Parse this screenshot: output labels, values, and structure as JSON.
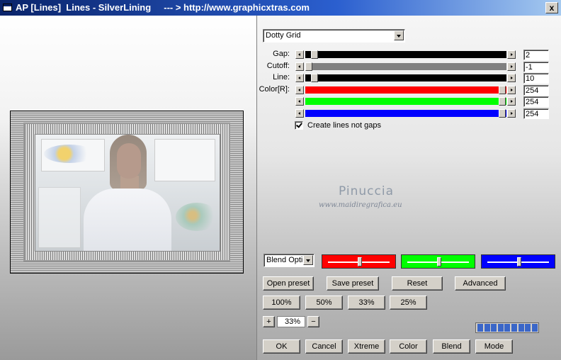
{
  "window": {
    "title": "AP [Lines]  Lines - SilverLining     --- > http://www.graphicxtras.com",
    "close_label": "x"
  },
  "effect": {
    "selected": "Dotty Grid"
  },
  "sliders": [
    {
      "label": "Gap:",
      "value": "2",
      "color": "#000000",
      "level": 0.03
    },
    {
      "label": "Cutoff:",
      "value": "-1",
      "color": "#808080",
      "level": 0.0
    },
    {
      "label": "Line:",
      "value": "10",
      "color": "#000000",
      "level": 0.03
    },
    {
      "label": "Color[R]:",
      "value": "254",
      "color": "#ff0000",
      "level": 0.996
    },
    {
      "label": "",
      "value": "254",
      "color": "#00ff00",
      "level": 0.996
    },
    {
      "label": "",
      "value": "254",
      "color": "#0000ff",
      "level": 0.996
    }
  ],
  "checkbox": {
    "label": "Create lines not gaps",
    "checked": true
  },
  "watermark": {
    "name": "Pinuccia",
    "site": "www.maidiregrafica.eu"
  },
  "blend": {
    "select_label": "Blend Optio",
    "rgb_sliders": [
      {
        "color": "#ff0000",
        "level": 0.5
      },
      {
        "color": "#00ff00",
        "level": 0.5
      },
      {
        "color": "#0000ff",
        "level": 0.5
      }
    ]
  },
  "buttons": {
    "open_preset": "Open preset",
    "save_preset": "Save preset",
    "reset": "Reset",
    "advanced": "Advanced",
    "zoom100": "100%",
    "zoom50": "50%",
    "zoom33": "33%",
    "zoom25": "25%",
    "zoom_plus": "+",
    "zoom_minus": "−",
    "ok": "OK",
    "cancel": "Cancel",
    "xtreme": "Xtreme",
    "color": "Color",
    "blend": "Blend",
    "mode": "Mode"
  },
  "zoom": {
    "value": "33%"
  },
  "progress": {
    "cells": 9,
    "level": 1.0
  }
}
